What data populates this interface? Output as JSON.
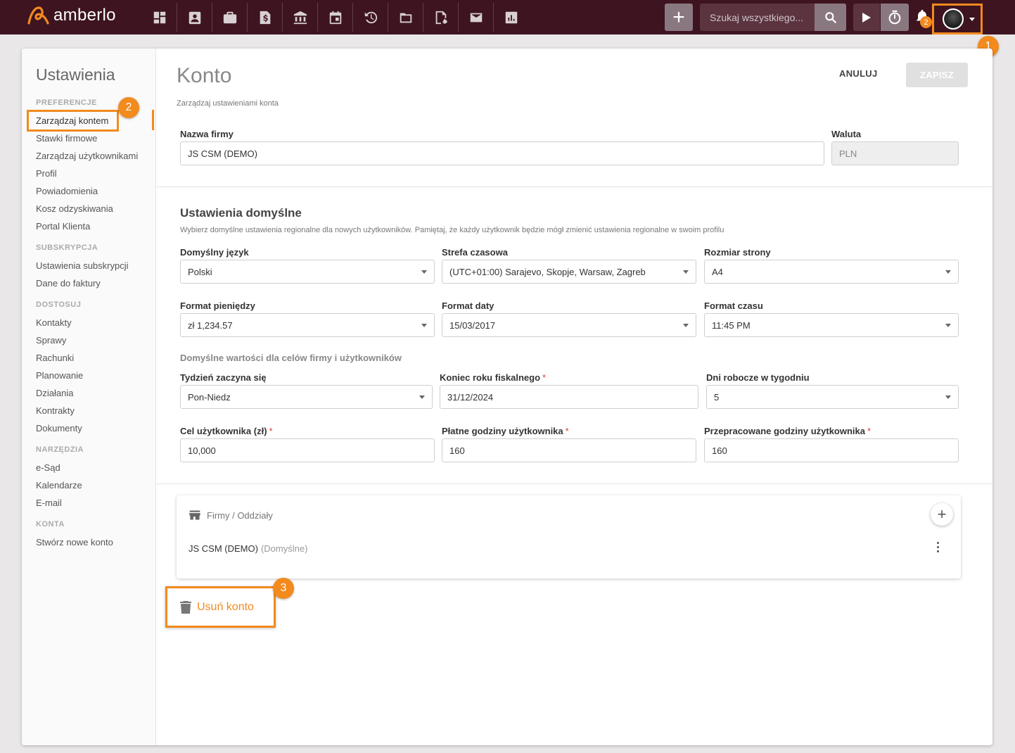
{
  "topbar": {
    "brand": "amberlo",
    "nav_icons": [
      "dashboard-icon",
      "contacts-icon",
      "briefcase-icon",
      "invoice-icon",
      "bank-icon",
      "calendar-icon",
      "time-history-icon",
      "folder-icon",
      "document-settings-icon",
      "mail-icon",
      "reports-icon"
    ],
    "search_placeholder": "Szukaj wszystkiego...",
    "notifications_count": "2",
    "accent_color": "#f28a1e",
    "bar_color": "#3e1420"
  },
  "callouts": {
    "one": "1",
    "two": "2",
    "three": "3"
  },
  "sidebar": {
    "title": "Ustawienia",
    "sections": [
      {
        "label": "PREFERENCJE",
        "items": [
          "Zarządzaj kontem",
          "Stawki firmowe",
          "Zarządzaj użytkownikami",
          "Profil",
          "Powiadomienia",
          "Kosz odzyskiwania",
          "Portal Klienta"
        ]
      },
      {
        "label": "SUBSKRYPCJA",
        "items": [
          "Ustawienia subskrypcji",
          "Dane do faktury"
        ]
      },
      {
        "label": "DOSTOSUJ",
        "items": [
          "Kontakty",
          "Sprawy",
          "Rachunki",
          "Planowanie",
          "Działania",
          "Kontrakty",
          "Dokumenty"
        ]
      },
      {
        "label": "NARZĘDZIA",
        "items": [
          "e-Sąd",
          "Kalendarze",
          "E-mail"
        ]
      },
      {
        "label": "KONTA",
        "items": [
          "Stwórz nowe konto"
        ]
      }
    ],
    "active_item": "Zarządzaj kontem"
  },
  "main": {
    "title": "Konto",
    "subtitle": "Zarządzaj ustawieniami konta",
    "cancel_label": "ANULUJ",
    "save_label": "ZAPISZ",
    "company": {
      "label": "Nazwa firmy",
      "value": "JS CSM (DEMO)"
    },
    "currency": {
      "label": "Waluta",
      "value": "PLN"
    },
    "defaults": {
      "title": "Ustawienia domyślne",
      "description": "Wybierz domyślne ustawienia regionalne dla nowych użytkowników. Pamiętaj, że każdy użytkownik będzie mógł zmienić ustawienia regionalne w swoim profilu",
      "language": {
        "label": "Domyślny język",
        "value": "Polski"
      },
      "timezone": {
        "label": "Strefa czasowa",
        "value": "(UTC+01:00) Sarajevo, Skopje, Warsaw, Zagreb"
      },
      "page_size": {
        "label": "Rozmiar strony",
        "value": "A4"
      },
      "money_format": {
        "label": "Format pieniędzy",
        "value": "zł 1,234.57"
      },
      "date_format": {
        "label": "Format daty",
        "value": "15/03/2017"
      },
      "time_format": {
        "label": "Format czasu",
        "value": "11:45 PM"
      }
    },
    "goals": {
      "heading": "Domyślne wartości dla celów firmy i użytkowników",
      "week_start": {
        "label": "Tydzień zaczyna się",
        "value": "Pon-Niedz"
      },
      "fiscal_end": {
        "label": "Koniec roku fiskalnego",
        "value": "31/12/2024",
        "required": "*"
      },
      "work_days": {
        "label": "Dni robocze w tygodniu",
        "value": "5"
      },
      "user_goal": {
        "label": "Cel użytkownika (zł)",
        "value": "10,000",
        "required": "*"
      },
      "billable_hours": {
        "label": "Płatne godziny użytkownika",
        "value": "160",
        "required": "*"
      },
      "worked_hours": {
        "label": "Przepracowane godziny użytkownika",
        "value": "160",
        "required": "*"
      }
    },
    "branches": {
      "title": "Firmy / Oddziały",
      "items": [
        {
          "name": "JS CSM (DEMO)",
          "tag": "(Domyślne)"
        }
      ]
    },
    "delete_label": "Usuń konto"
  }
}
